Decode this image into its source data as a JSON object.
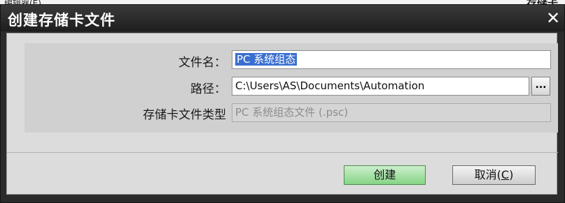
{
  "background_app": {
    "left_text": "编辑器(E)",
    "right_text": "存储卡"
  },
  "dialog": {
    "title": "创建存储卡文件",
    "close_glyph": "✕",
    "fields": {
      "filename": {
        "label": "文件名：",
        "value": "PC 系统组态"
      },
      "path": {
        "label": "路径：",
        "value": "C:\\Users\\AS\\Documents\\Automation",
        "browse_label": "..."
      },
      "file_type": {
        "label": "存储卡文件类型",
        "value": "PC 系统组态文件 (.psc)"
      }
    },
    "buttons": {
      "create": "创建",
      "cancel_prefix": "取消(",
      "cancel_accel": "C",
      "cancel_suffix": ")"
    }
  },
  "colors": {
    "title_bar": "#2b2b2b",
    "selection": "#3a6fd0",
    "primary_button": "#86d486"
  }
}
